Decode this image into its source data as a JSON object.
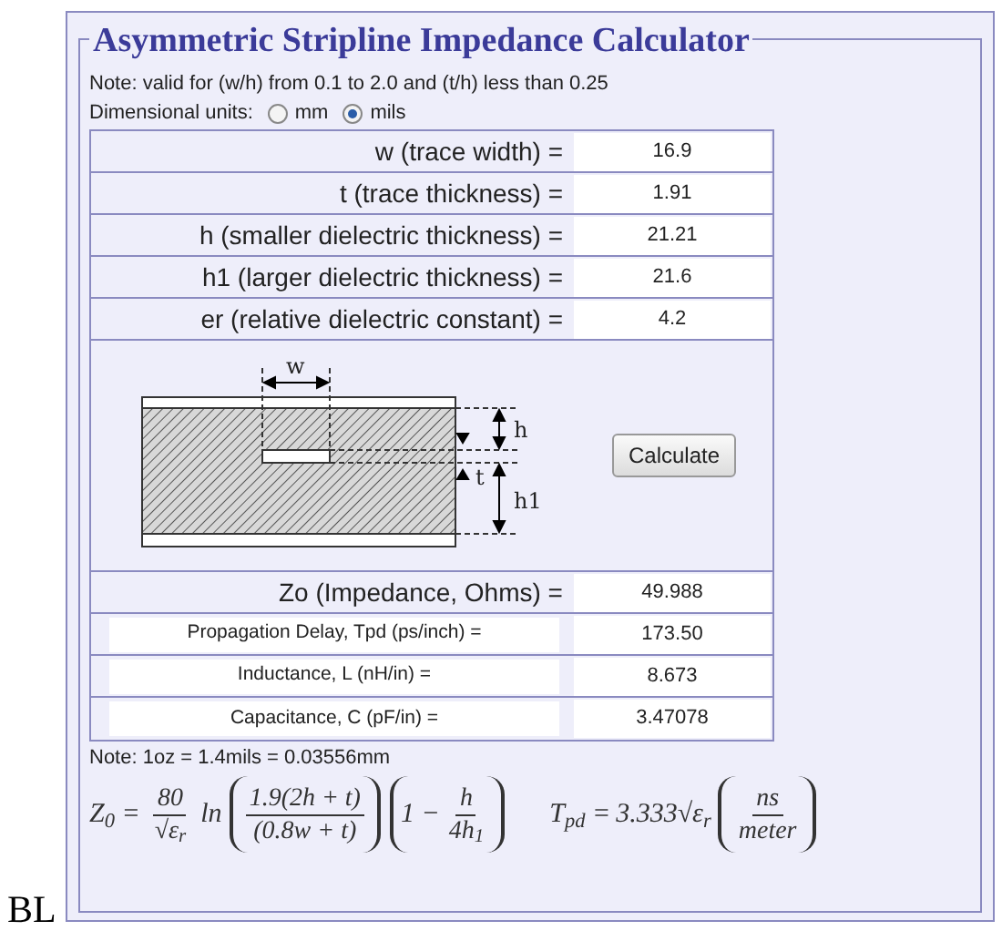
{
  "title": "Asymmetric Stripline Impedance Calculator",
  "note": "Note: valid for (w/h) from 0.1 to 2.0 and (t/h) less than 0.25",
  "units": {
    "label": "Dimensional units:",
    "options": [
      {
        "label": "mm",
        "selected": false
      },
      {
        "label": "mils",
        "selected": true
      }
    ]
  },
  "inputs": [
    {
      "label": "w (trace width) =",
      "value": "16.9"
    },
    {
      "label": "t (trace thickness) =",
      "value": "1.91"
    },
    {
      "label": "h (smaller dielectric thickness) =",
      "value": "21.21"
    },
    {
      "label": "h1 (larger dielectric thickness) =",
      "value": "21.6"
    },
    {
      "label": "er (relative dielectric constant) =",
      "value": "4.2"
    }
  ],
  "diagram": {
    "labels": [
      "w",
      "h",
      "t",
      "h1"
    ]
  },
  "calculate_button": "Calculate",
  "outputs": [
    {
      "kind": "primary",
      "label": "Zo (Impedance, Ohms) =",
      "value": "49.988"
    },
    {
      "kind": "secondary",
      "label": "Propagation Delay, Tpd (ps/inch) =",
      "value": "173.50"
    },
    {
      "kind": "secondary",
      "label": "Inductance, L (nH/in) =",
      "value": "8.673"
    },
    {
      "kind": "secondary",
      "label": "Capacitance, C (pF/in) =",
      "value": "3.47078"
    }
  ],
  "footnote": "Note: 1oz = 1.4mils = 0.03556mm",
  "formulas": [
    {
      "parts": [
        {
          "kind": "text",
          "text": "Z$_{0}$ ="
        },
        {
          "kind": "frac",
          "num": "80",
          "den": "√ε$_{r}$"
        },
        {
          "kind": "text",
          "text": "ln"
        },
        {
          "kind": "paren",
          "parts": [
            {
              "kind": "frac",
              "num": "1.9(2h + t)",
              "den": "(0.8w + t)"
            }
          ]
        },
        {
          "kind": "paren",
          "parts": [
            {
              "kind": "text",
              "text": "1 −"
            },
            {
              "kind": "frac",
              "num": "h",
              "den": "4h$_{1}$"
            }
          ]
        }
      ]
    },
    {
      "parts": [
        {
          "kind": "text",
          "text": "T$_{pd}$ ="
        },
        {
          "kind": "text",
          "text": "3.333√ε$_{r}$"
        },
        {
          "kind": "paren",
          "parts": [
            {
              "kind": "frac",
              "num": "ns",
              "den": "meter"
            }
          ]
        }
      ]
    }
  ],
  "corner_text": "BL"
}
